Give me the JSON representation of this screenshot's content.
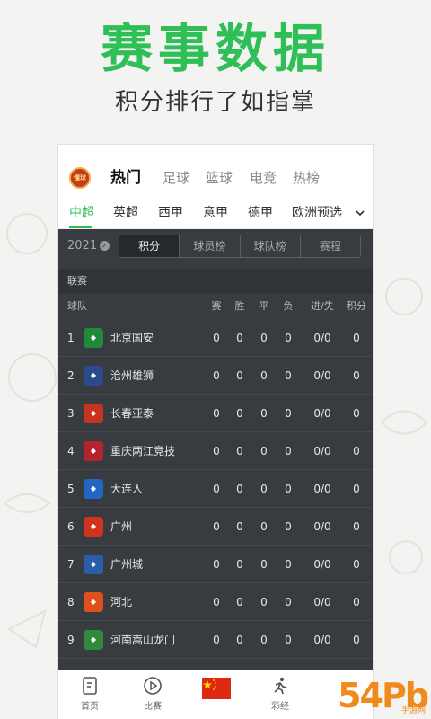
{
  "hero": {
    "title": "赛事数据",
    "subtitle": "积分排行了如指掌"
  },
  "app": {
    "logo_text": "懂球",
    "main_tabs": [
      "热门",
      "足球",
      "篮球",
      "电竞",
      "热榜"
    ],
    "active_main_tab": "热门",
    "league_tabs": [
      "中超",
      "英超",
      "西甲",
      "意甲",
      "德甲",
      "欧洲预选"
    ],
    "active_league_tab": "中超",
    "expand_icon": "chevron-down-icon"
  },
  "standings": {
    "season": "2021",
    "segments": [
      "积分",
      "球员榜",
      "球队榜",
      "赛程"
    ],
    "active_segment": "积分",
    "section_label": "联赛",
    "headers": {
      "team": "球队",
      "played": "赛",
      "won": "胜",
      "drawn": "平",
      "lost": "负",
      "goals": "进/失",
      "points": "积分"
    },
    "rows": [
      {
        "rank": "1",
        "team": "北京国安",
        "played": "0",
        "won": "0",
        "drawn": "0",
        "lost": "0",
        "goals": "0/0",
        "points": "0",
        "badge_color": "#1f8a3a"
      },
      {
        "rank": "2",
        "team": "沧州雄狮",
        "played": "0",
        "won": "0",
        "drawn": "0",
        "lost": "0",
        "goals": "0/0",
        "points": "0",
        "badge_color": "#2b4a8c"
      },
      {
        "rank": "3",
        "team": "长春亚泰",
        "played": "0",
        "won": "0",
        "drawn": "0",
        "lost": "0",
        "goals": "0/0",
        "points": "0",
        "badge_color": "#c8321e"
      },
      {
        "rank": "4",
        "team": "重庆两江竞技",
        "played": "0",
        "won": "0",
        "drawn": "0",
        "lost": "0",
        "goals": "0/0",
        "points": "0",
        "badge_color": "#b5232f"
      },
      {
        "rank": "5",
        "team": "大连人",
        "played": "0",
        "won": "0",
        "drawn": "0",
        "lost": "0",
        "goals": "0/0",
        "points": "0",
        "badge_color": "#2166c4"
      },
      {
        "rank": "6",
        "team": "广州",
        "played": "0",
        "won": "0",
        "drawn": "0",
        "lost": "0",
        "goals": "0/0",
        "points": "0",
        "badge_color": "#d2331c"
      },
      {
        "rank": "7",
        "team": "广州城",
        "played": "0",
        "won": "0",
        "drawn": "0",
        "lost": "0",
        "goals": "0/0",
        "points": "0",
        "badge_color": "#2a5ea8"
      },
      {
        "rank": "8",
        "team": "河北",
        "played": "0",
        "won": "0",
        "drawn": "0",
        "lost": "0",
        "goals": "0/0",
        "points": "0",
        "badge_color": "#e0501e"
      },
      {
        "rank": "9",
        "team": "河南嵩山龙门",
        "played": "0",
        "won": "0",
        "drawn": "0",
        "lost": "0",
        "goals": "0/0",
        "points": "0",
        "badge_color": "#2f8a3c"
      }
    ]
  },
  "bottom_nav": [
    {
      "label": "首页",
      "icon": "home-doc-icon"
    },
    {
      "label": "比赛",
      "icon": "play-circle-icon"
    },
    {
      "label": "",
      "icon": "china-flag-icon"
    },
    {
      "label": "彩经",
      "icon": "runner-icon"
    }
  ],
  "watermark": {
    "text": "54Pb",
    "sub": "手游网"
  },
  "colors": {
    "accent": "#2fbf57",
    "dark_bg": "#383b40"
  }
}
